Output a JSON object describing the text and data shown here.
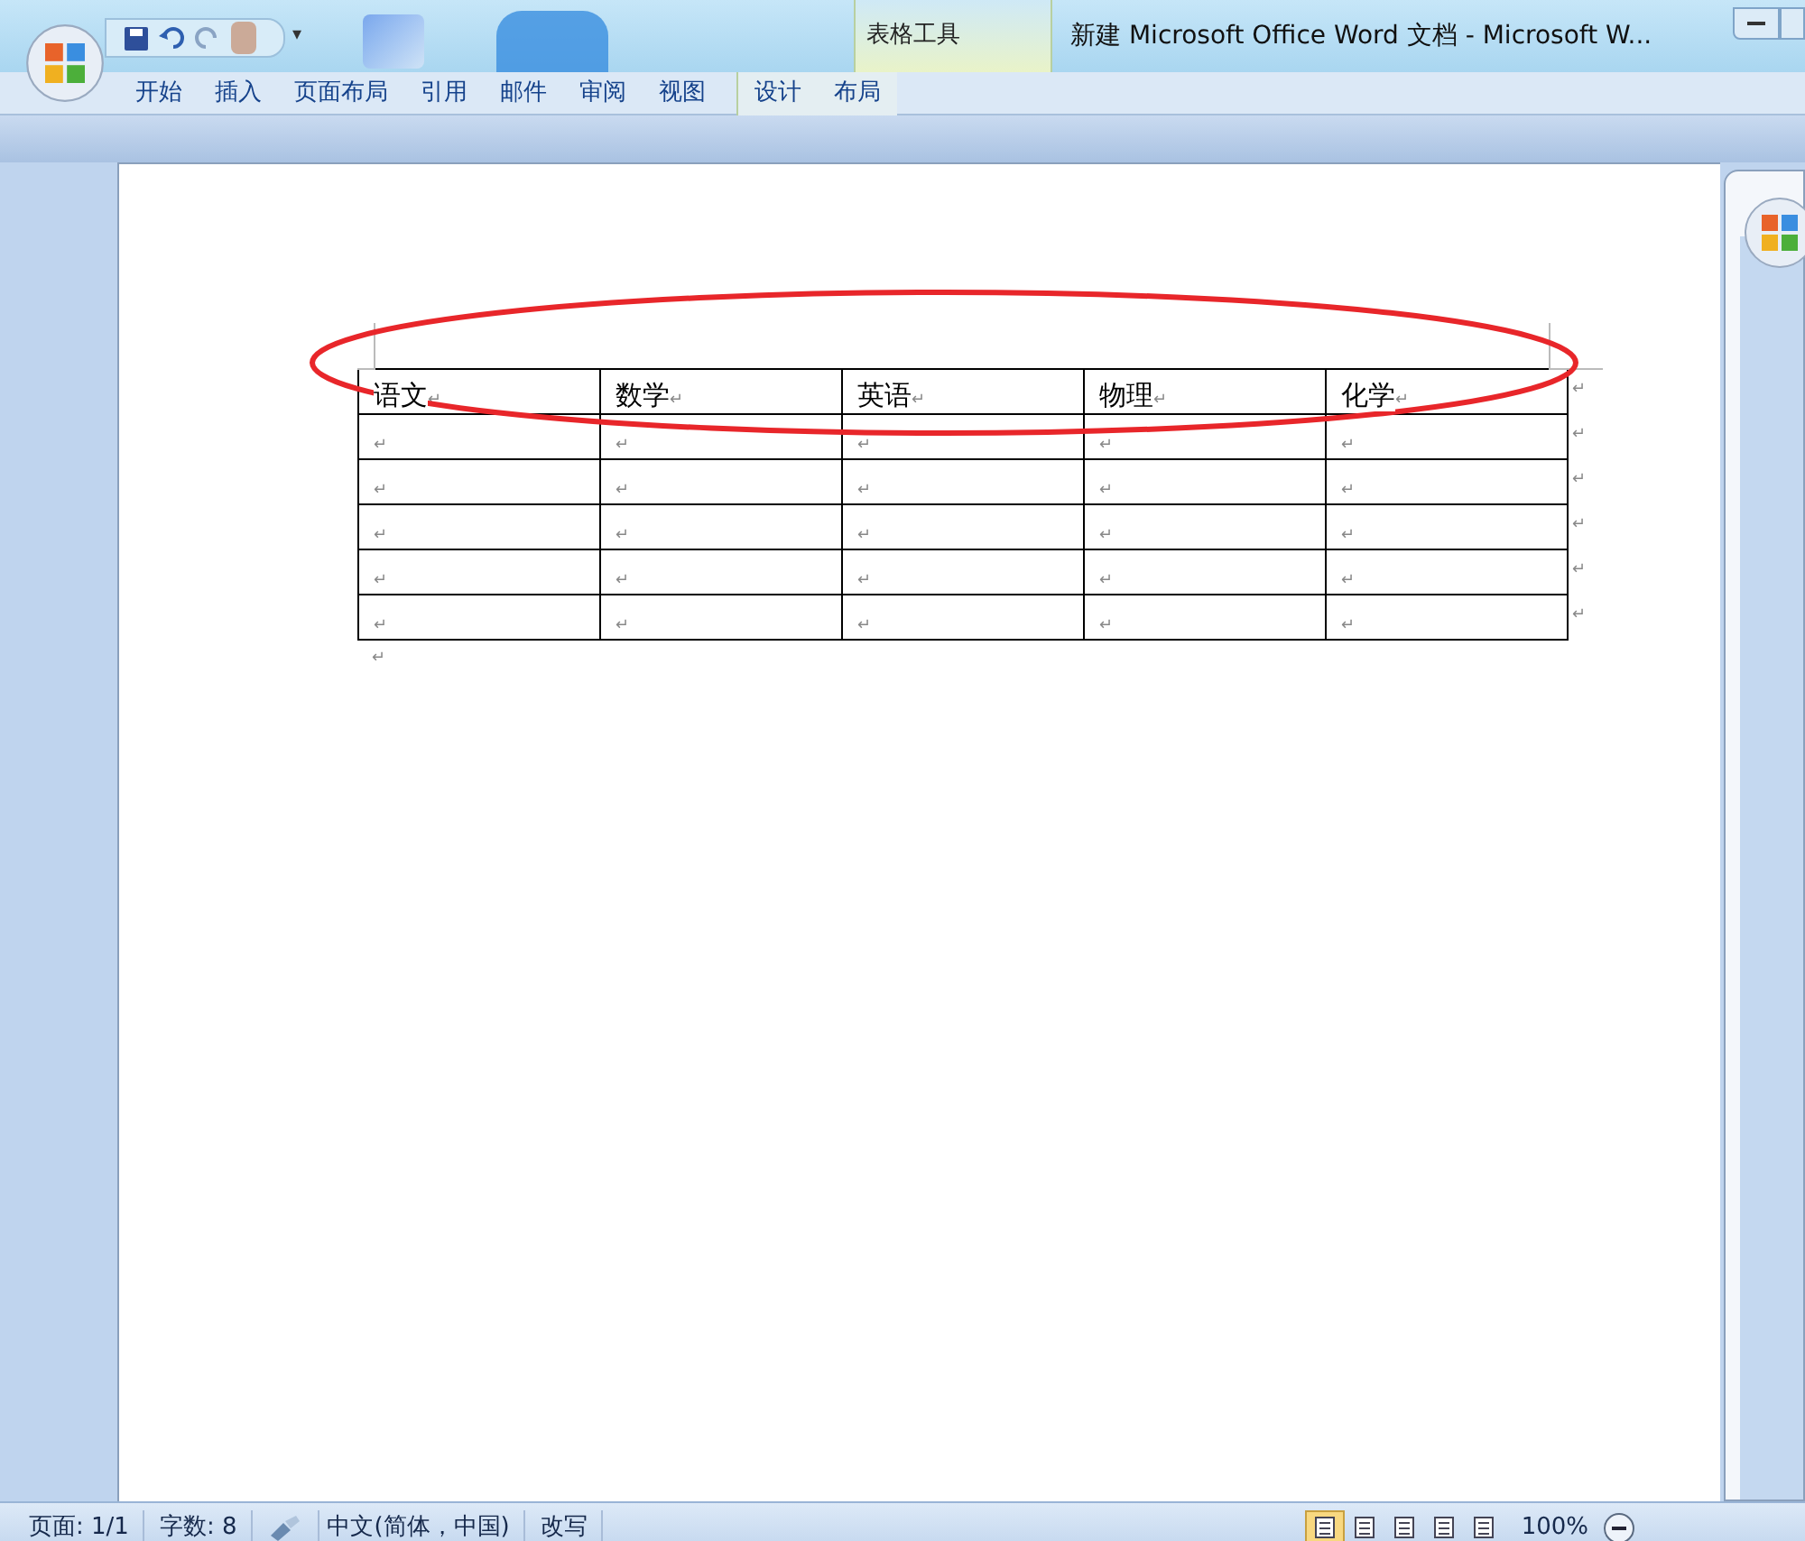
{
  "window": {
    "title": "新建 Microsoft Office Word 文档 - Microsoft W..."
  },
  "quick_access": {
    "more": "▾"
  },
  "contextual_group": {
    "label": "表格工具"
  },
  "tabs": [
    {
      "label": "开始",
      "selected": false
    },
    {
      "label": "插入",
      "selected": false
    },
    {
      "label": "页面布局",
      "selected": false
    },
    {
      "label": "引用",
      "selected": false
    },
    {
      "label": "邮件",
      "selected": false
    },
    {
      "label": "审阅",
      "selected": false
    },
    {
      "label": "视图",
      "selected": false
    },
    {
      "label": "设计",
      "selected": false,
      "contextual": true
    },
    {
      "label": "布局",
      "selected": false,
      "contextual": true
    }
  ],
  "table": {
    "rows": [
      [
        {
          "text": "语文",
          "mark": "↵"
        },
        {
          "text": "数学",
          "mark": "↵"
        },
        {
          "text": "英语",
          "mark": "↵"
        },
        {
          "text": "物理",
          "mark": "↵"
        },
        {
          "text": "化学",
          "mark": "↵"
        }
      ],
      [
        {
          "mark": "↵"
        },
        {
          "mark": "↵"
        },
        {
          "mark": "↵"
        },
        {
          "mark": "↵"
        },
        {
          "mark": "↵"
        }
      ],
      [
        {
          "mark": "↵"
        },
        {
          "mark": "↵"
        },
        {
          "mark": "↵"
        },
        {
          "mark": "↵"
        },
        {
          "mark": "↵"
        }
      ],
      [
        {
          "mark": "↵"
        },
        {
          "mark": "↵"
        },
        {
          "mark": "↵"
        },
        {
          "mark": "↵"
        },
        {
          "mark": "↵"
        }
      ],
      [
        {
          "mark": "↵"
        },
        {
          "mark": "↵"
        },
        {
          "mark": "↵"
        },
        {
          "mark": "↵"
        },
        {
          "mark": "↵"
        }
      ],
      [
        {
          "mark": "↵"
        },
        {
          "mark": "↵"
        },
        {
          "mark": "↵"
        },
        {
          "mark": "↵"
        },
        {
          "mark": "↵"
        }
      ]
    ],
    "row_end_marks": [
      "↵",
      "↵",
      "↵",
      "↵",
      "↵",
      "↵"
    ]
  },
  "after_table_mark": "↵",
  "status_bar": {
    "page": "页面: 1/1",
    "words": "字数: 8",
    "language": "中文(简体，中国)",
    "mode": "改写",
    "zoom": "100%",
    "views": [
      {
        "selected": true
      },
      {
        "selected": false
      },
      {
        "selected": false
      },
      {
        "selected": false
      },
      {
        "selected": false
      }
    ]
  }
}
